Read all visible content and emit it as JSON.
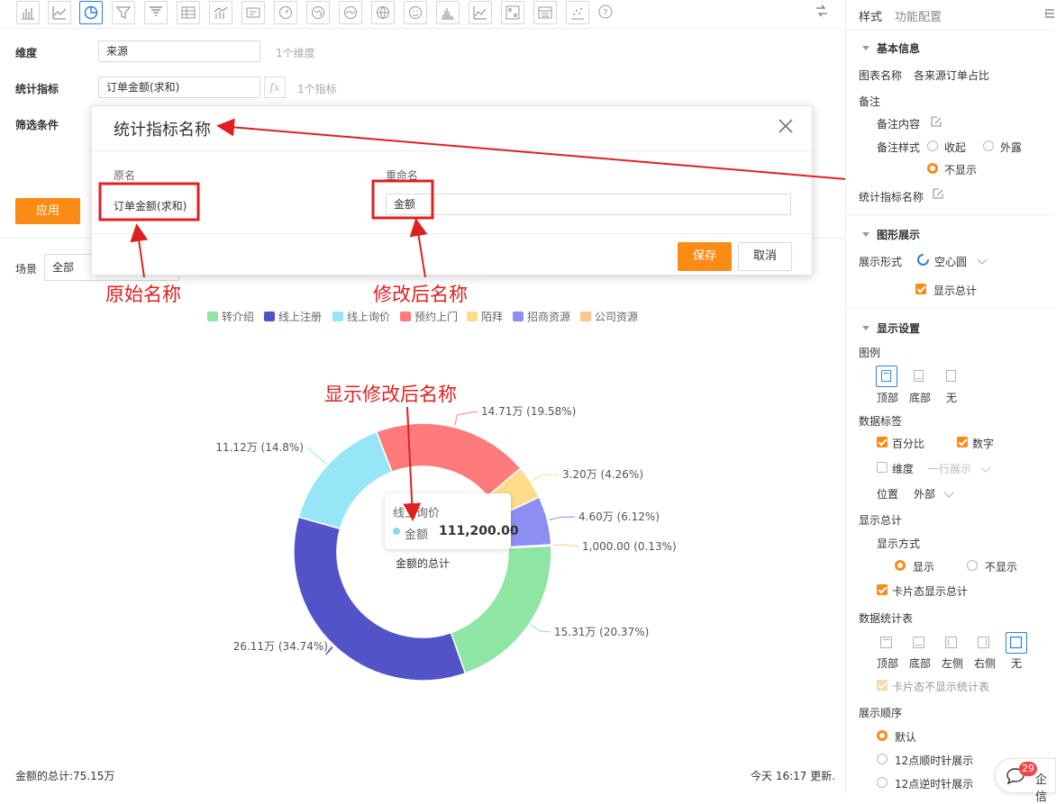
{
  "form": {
    "dimension_label": "维度",
    "dimension_value": "来源",
    "dimension_hint": "1个维度",
    "metric_label": "统计指标",
    "metric_value": "订单金额(求和)",
    "metric_hint": "1个指标",
    "filter_label": "筛选条件",
    "apply_label": "应用",
    "scene_label": "场景",
    "scene_value": "全部"
  },
  "dialog": {
    "title": "统计指标名称",
    "col_original": "原名",
    "col_rename": "重命名",
    "original_value": "订单金额(求和)",
    "rename_value": "金额",
    "save_label": "保存",
    "cancel_label": "取消"
  },
  "annotations": {
    "original_name": "原始名称",
    "modified_name": "修改后名称",
    "show_modified": "显示修改后名称"
  },
  "chart_data": {
    "type": "pie",
    "variant": "donut",
    "legend": [
      "转介绍",
      "线上注册",
      "线上询价",
      "预约上门",
      "陌拜",
      "招商资源",
      "公司资源"
    ],
    "legend_placement": "top-center",
    "slices": [
      {
        "name": "预约上门",
        "value": 147100,
        "label": "14.71万 (19.58%)",
        "color": "#ff7b7b"
      },
      {
        "name": "陌拜",
        "value": 32000,
        "label": "3.20万 (4.26%)",
        "color": "#ffdc8a"
      },
      {
        "name": "招商资源",
        "value": 46000,
        "label": "4.60万 (6.12%)",
        "color": "#8e8ef2"
      },
      {
        "name": "公司资源",
        "value": 1000,
        "label": "1,000.00 (0.13%)",
        "color": "#ffc58a"
      },
      {
        "name": "转介绍",
        "value": 153100,
        "label": "15.31万 (20.37%)",
        "color": "#8ee5a4"
      },
      {
        "name": "线上注册",
        "value": 261100,
        "label": "26.11万 (34.74%)",
        "color": "#5353c9"
      },
      {
        "name": "线上询价",
        "value": 111200,
        "label": "11.12万 (14.8%)",
        "color": "#96e6f8"
      }
    ],
    "tooltip": {
      "category": "线上询价",
      "series": "金额",
      "value": "111,200.00"
    },
    "center_label": "金额的总计",
    "footer_total": "金额的总计:75.15万",
    "updated": "今天 16:17 更新."
  },
  "panel": {
    "tab_style": "样式",
    "tab_config": "功能配置",
    "sec_basic": "基本信息",
    "chart_name_label": "图表名称",
    "chart_name_value": "各来源订单占比",
    "note_label": "备注",
    "note_content_label": "备注内容",
    "note_style_label": "备注样式",
    "note_style_opts": [
      "收起",
      "外露",
      "不显示"
    ],
    "metric_name_label": "统计指标名称",
    "sec_graph": "图形展示",
    "display_form_label": "展示形式",
    "display_form_value": "空心圆",
    "show_total_check": "显示总计",
    "sec_display": "显示设置",
    "legend_label": "图例",
    "legend_opts": [
      "顶部",
      "底部",
      "无"
    ],
    "data_label_label": "数据标签",
    "data_label_opts": [
      "百分比",
      "数字",
      "维度"
    ],
    "single_row": "一行展示",
    "position_label": "位置",
    "position_value": "外部",
    "show_total_label": "显示总计",
    "show_mode_label": "显示方式",
    "show_mode_opts": [
      "显示",
      "不显示"
    ],
    "card_total": "卡片态显示总计",
    "stat_table_label": "数据统计表",
    "stat_table_opts": [
      "顶部",
      "底部",
      "左侧",
      "右侧",
      "无"
    ],
    "card_no_table": "卡片态不显示统计表",
    "order_label": "展示顺序",
    "order_opts": [
      "默认",
      "12点顺时针展示",
      "12点逆时针展示"
    ],
    "chat_badge": "29",
    "chat_label": "企信"
  },
  "colors": {
    "accent": "#fa8c16",
    "blue": "#2e7de1",
    "annotation": "#e02020"
  }
}
